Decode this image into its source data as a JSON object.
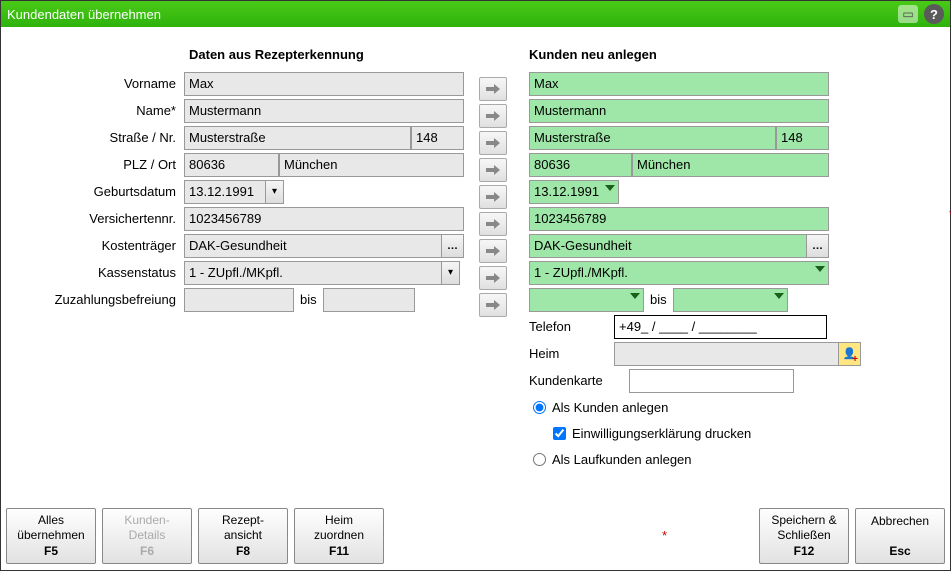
{
  "title": "Kundendaten übernehmen",
  "sections": {
    "left_title": "Daten aus Rezepterkennung",
    "right_title": "Kunden neu anlegen"
  },
  "labels": {
    "vorname": "Vorname",
    "name": "Name*",
    "strasse": "Straße / Nr.",
    "plzort": "PLZ / Ort",
    "gdatum": "Geburtsdatum",
    "vnr": "Versichertennr.",
    "kost": "Kostenträger",
    "kstat": "Kassenstatus",
    "zuz": "Zuzahlungsbefreiung",
    "bis": "bis",
    "telefon": "Telefon",
    "heim": "Heim",
    "karte": "Kundenkarte"
  },
  "left": {
    "vorname": "Max",
    "name": "Mustermann",
    "strasse": "Musterstraße",
    "nr": "148",
    "plz": "80636",
    "ort": "München",
    "gdatum": "13.12.1991",
    "vnr": "1023456789",
    "kost": "DAK-Gesundheit",
    "kstat": "1 - ZUpfl./MKpfl.",
    "zuz_from": "",
    "zuz_to": ""
  },
  "right": {
    "vorname": "Max",
    "name": "Mustermann",
    "strasse": "Musterstraße",
    "nr": "148",
    "plz": "80636",
    "ort": "München",
    "gdatum": "13.12.1991",
    "vnr": "1023456789",
    "kost": "DAK-Gesundheit",
    "kstat": "1 - ZUpfl./MKpfl.",
    "zuz_from": "",
    "zuz_to": "",
    "telefon": "+49_ / ____ / ________",
    "heim": "",
    "karte": ""
  },
  "options": {
    "als_kunden": "Als Kunden anlegen",
    "einwilligung": "Einwilligungserklärung drucken",
    "als_laufkunden": "Als Laufkunden anlegen"
  },
  "footer": {
    "alles": {
      "label1": "Alles",
      "label2": "übernehmen",
      "key": "F5"
    },
    "details": {
      "label1": "Kunden-",
      "label2": "Details",
      "key": "F6"
    },
    "rezept": {
      "label1": "Rezept-",
      "label2": "ansicht",
      "key": "F8"
    },
    "heim": {
      "label1": "Heim",
      "label2": "zuordnen",
      "key": "F11"
    },
    "speichern": {
      "label1": "Speichern &",
      "label2": "Schließen",
      "key": "F12"
    },
    "abbrechen": {
      "label1": "Abbrechen",
      "label2": "",
      "key": "Esc"
    }
  }
}
